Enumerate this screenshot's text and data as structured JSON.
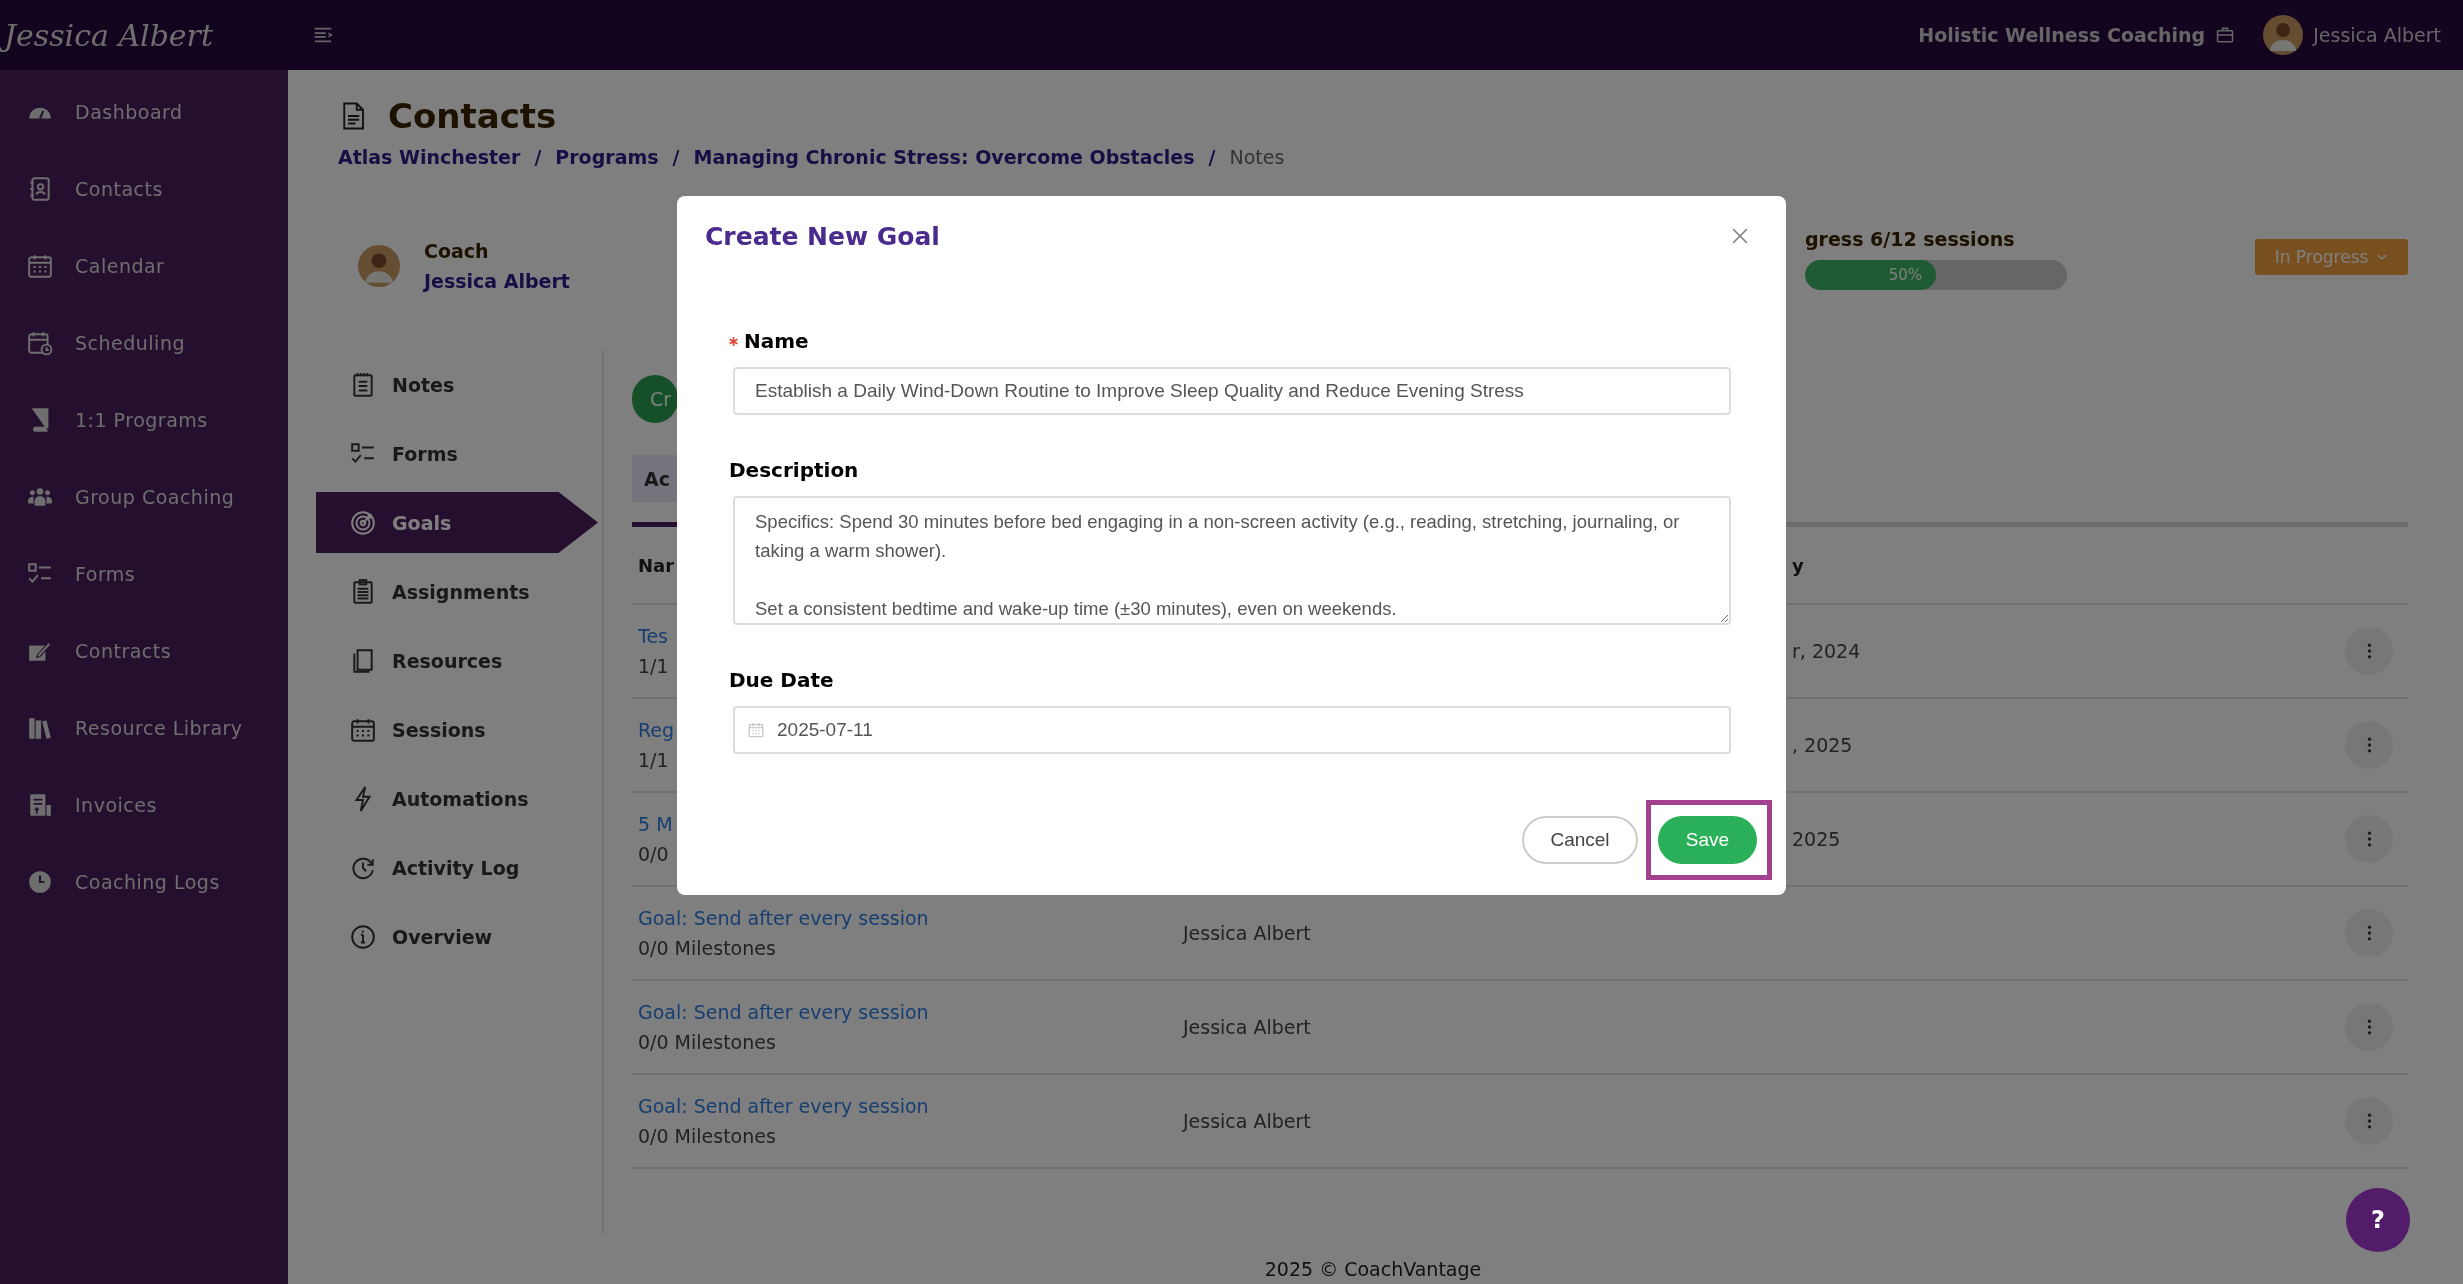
{
  "topbar": {
    "logo": "Jessica Albert",
    "business": "Holistic Wellness Coaching",
    "user": "Jessica Albert"
  },
  "sidebar": {
    "items": [
      "Dashboard",
      "Contacts",
      "Calendar",
      "Scheduling",
      "1:1 Programs",
      "Group Coaching",
      "Forms",
      "Contracts",
      "Resource Library",
      "Invoices",
      "Coaching Logs"
    ]
  },
  "page": {
    "title": "Contacts",
    "breadcrumb": [
      {
        "label": "Atlas Winchester",
        "kind": "link"
      },
      {
        "label": "Programs",
        "kind": "link"
      },
      {
        "label": "Managing Chronic Stress: Overcome Obstacles",
        "kind": "link"
      },
      {
        "label": "Notes",
        "kind": "current"
      }
    ],
    "separator": "/"
  },
  "coach": {
    "role": "Coach",
    "name": "Jessica Albert"
  },
  "progress": {
    "label": "gress 6/12 sessions",
    "level": 0.5,
    "reading": "50%"
  },
  "status_button": "In Progress",
  "subnav": [
    {
      "label": "Notes",
      "selected": false
    },
    {
      "label": "Forms",
      "selected": false
    },
    {
      "label": "Goals",
      "selected": true
    },
    {
      "label": "Assignments",
      "selected": false
    },
    {
      "label": "Resources",
      "selected": false
    },
    {
      "label": "Sessions",
      "selected": false
    },
    {
      "label": "Automations",
      "selected": false
    },
    {
      "label": "Activity Log",
      "selected": false
    },
    {
      "label": "Overview",
      "selected": false
    }
  ],
  "create_button": "Cr",
  "tabs": [
    {
      "label": "Ac",
      "selected": true
    }
  ],
  "table": {
    "header_1": "Nar",
    "header_3": "y",
    "rows": [
      {
        "name": "Tes",
        "milestones": "1/1",
        "column_3": "r, 2024"
      },
      {
        "name": "Reg",
        "milestones": "1/1",
        "column_3": ", 2025"
      },
      {
        "name": "5 M",
        "milestones": "0/0",
        "column_3": "2025"
      },
      {
        "name": "Goal: Send after every session",
        "milestones": "0/0 Milestones",
        "column_2": "Jessica Albert"
      },
      {
        "name": "Goal: Send after every session",
        "milestones": "0/0 Milestones",
        "column_2": "Jessica Albert"
      },
      {
        "name": "Goal: Send after every session",
        "milestones": "0/0 Milestones",
        "column_2": "Jessica Albert"
      }
    ]
  },
  "footer": "2025 © CoachVantage",
  "help_button": "?",
  "modal": {
    "title": "Create New Goal",
    "fields": [
      {
        "label": "Name",
        "required": true,
        "kind": "text",
        "value": "Establish a Daily Wind-Down Routine to Improve Sleep Quality and Reduce Evening Stress"
      },
      {
        "label": "Description",
        "required": false,
        "kind": "textarea",
        "value": "Specifics: Spend 30 minutes before bed engaging in a non-screen activity (e.g., reading, stretching, journaling, or taking a warm shower).\n\nSet a consistent bedtime and wake-up time (±30 minutes), even on weekends."
      },
      {
        "label": "Due Date",
        "required": false,
        "kind": "date",
        "value": "2025-07-11"
      }
    ],
    "buttons": [
      {
        "label": "Cancel",
        "kind": "secondary",
        "highlighted": false
      },
      {
        "label": "Save",
        "kind": "primary",
        "highlighted": true
      }
    ]
  }
}
